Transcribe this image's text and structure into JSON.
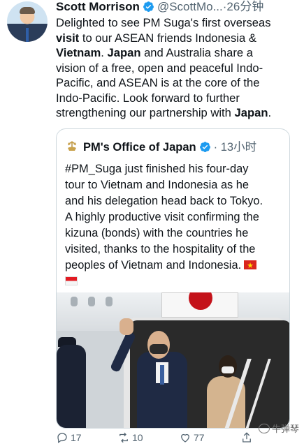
{
  "tweet": {
    "author_name": "Scott Morrison",
    "author_handle": "@ScottMo...",
    "separator": "·",
    "time": "26分钟",
    "lines": [
      [
        "Delighted to see PM Suga's first overseas"
      ],
      [
        "visit",
        " to our ASEAN friends Indonesia &"
      ],
      [
        "Vietnam",
        ". ",
        "Japan",
        " and Australia share a"
      ],
      [
        "vision of a free, open and peaceful Indo-"
      ],
      [
        "Pacific, and ASEAN is at the core of the"
      ],
      [
        "Indo-Pacific. Look forward to further"
      ],
      [
        "strengthening our partnership with ",
        "Japan",
        "."
      ]
    ]
  },
  "quote": {
    "author_name": "PM's Office of Japan",
    "separator": "·",
    "time": "13小时",
    "lines": [
      "#PM_Suga just finished his four-day",
      "tour to Vietnam and Indonesia as he",
      "and his delegation head back to Tokyo.",
      "A highly productive visit confirming the",
      "kizuna (bonds) with the countries he",
      "visited, thanks to the hospitality of the",
      "peoples of Vietnam and Indonesia."
    ]
  },
  "actions": {
    "reply_count": "17",
    "retweet_count": "10",
    "like_count": "77"
  },
  "watermark": {
    "text": "牛弹琴"
  },
  "colors": {
    "verified": "#1d9bf0",
    "muted": "#536471",
    "border": "#cfd9de"
  },
  "icons": [
    "verified-icon",
    "reply-icon",
    "retweet-icon",
    "like-icon",
    "share-icon",
    "japan-emblem-icon",
    "vietnam-flag-icon",
    "indonesia-flag-icon"
  ]
}
